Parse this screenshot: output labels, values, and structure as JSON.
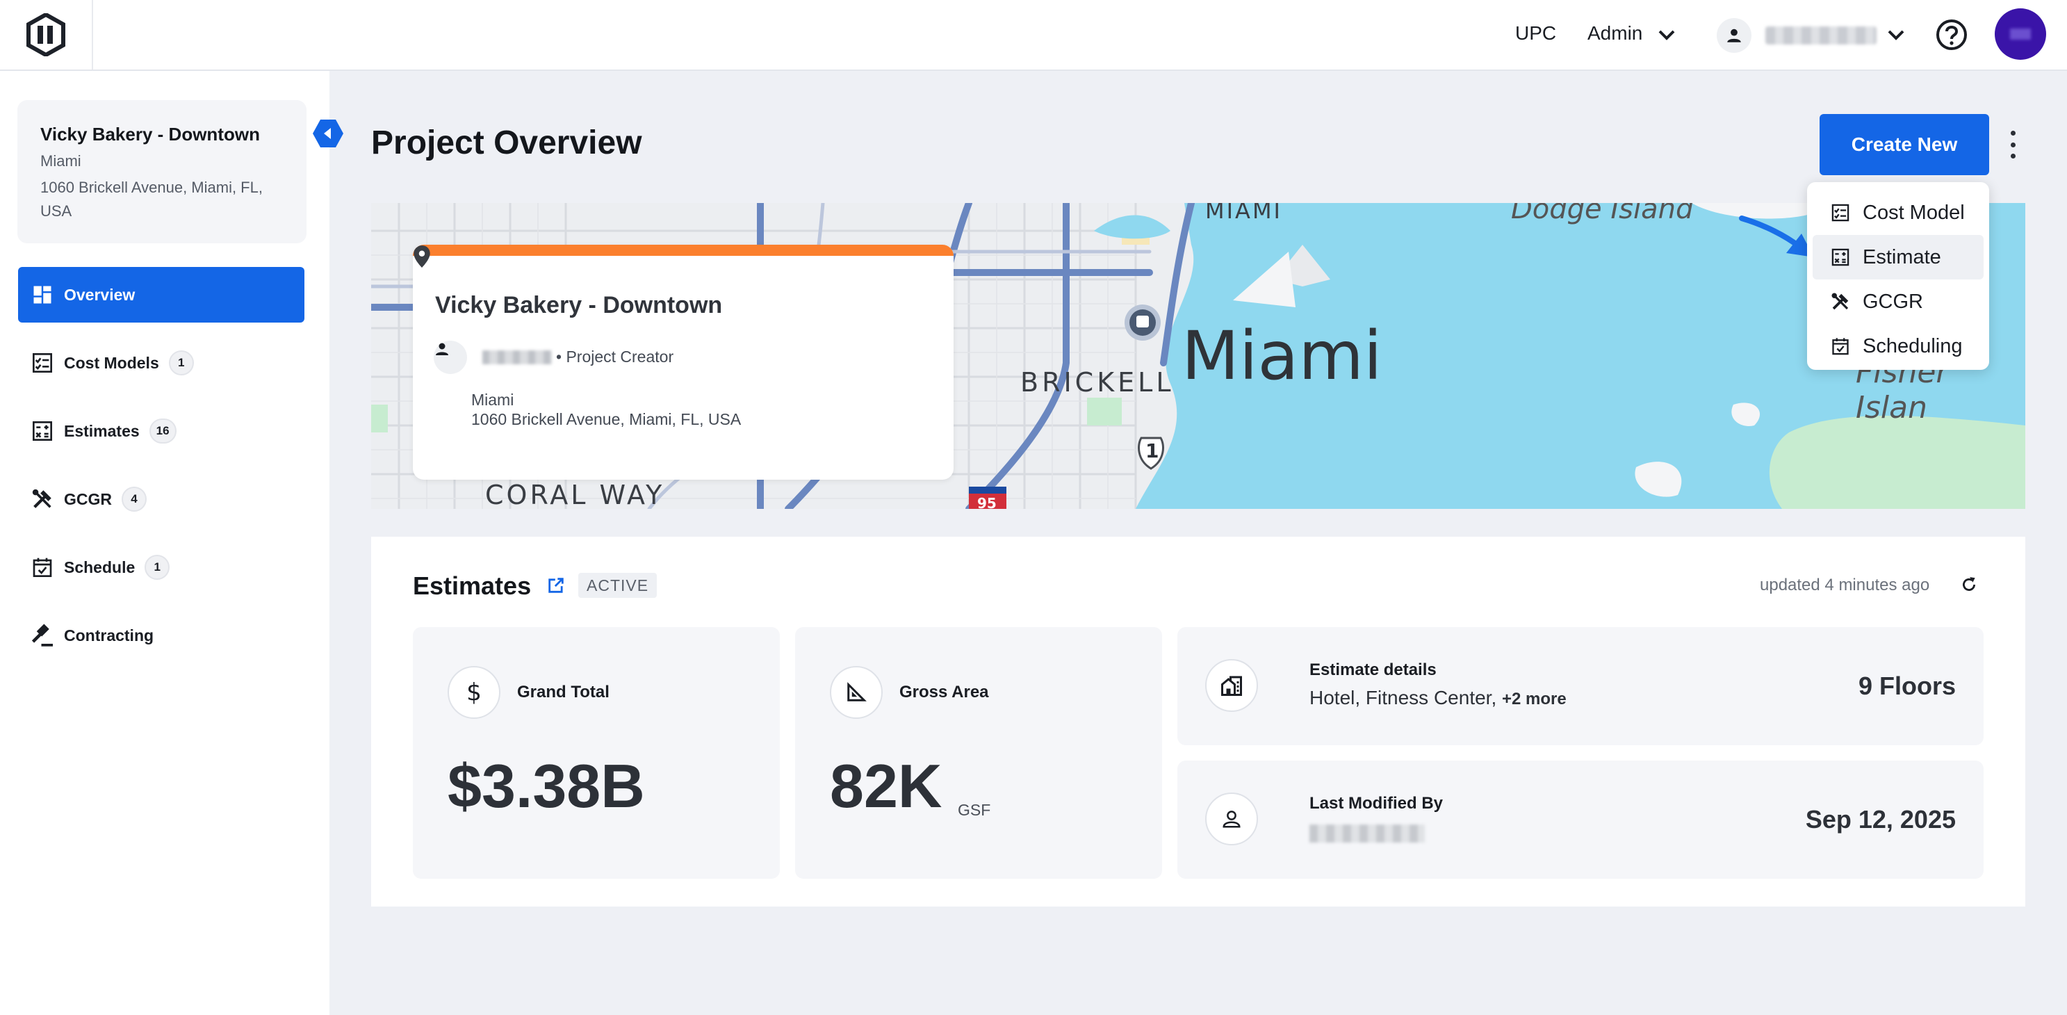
{
  "topbar": {
    "upc": "UPC",
    "admin": "Admin"
  },
  "project": {
    "name": "Vicky Bakery - Downtown",
    "city": "Miami",
    "address": "1060 Brickell Avenue, Miami, FL, USA"
  },
  "nav": [
    {
      "label": "Overview",
      "icon": "dashboard-icon",
      "badge": null,
      "active": true
    },
    {
      "label": "Cost Models",
      "icon": "checklist-icon",
      "badge": "1"
    },
    {
      "label": "Estimates",
      "icon": "calculator-icon",
      "badge": "16"
    },
    {
      "label": "GCGR",
      "icon": "tools-icon",
      "badge": "4"
    },
    {
      "label": "Schedule",
      "icon": "calendar-check-icon",
      "badge": "1"
    },
    {
      "label": "Contracting",
      "icon": "gavel-icon",
      "badge": null
    }
  ],
  "main": {
    "title": "Project Overview",
    "create_new": "Create New"
  },
  "dropdown": {
    "items": [
      {
        "label": "Cost Model",
        "icon": "checklist-icon"
      },
      {
        "label": "Estimate",
        "icon": "calculator-icon",
        "hover": true
      },
      {
        "label": "GCGR",
        "icon": "tools-icon"
      },
      {
        "label": "Scheduling",
        "icon": "calendar-check-icon"
      }
    ]
  },
  "map": {
    "labels": {
      "miami_top": "MIAMI",
      "dodge": "Dodge Island",
      "miami": "Miami",
      "brickell": "BRICKELL",
      "coral_way": "CORAL WAY",
      "fisher": "Fisher Islan",
      "us1": "1",
      "i95": "95"
    },
    "card": {
      "title": "Vicky Bakery - Downtown",
      "creator": "• Project Creator",
      "city": "Miami",
      "address": "1060 Brickell Avenue, Miami, FL, USA"
    }
  },
  "estimates": {
    "title": "Estimates",
    "status": "ACTIVE",
    "updated": "updated 4 minutes ago",
    "grand_total_label": "Grand Total",
    "grand_total_value": "$3.38B",
    "gross_area_label": "Gross Area",
    "gross_area_value": "82K",
    "gross_area_unit": "GSF",
    "details_label": "Estimate details",
    "details_value": "Hotel, Fitness Center,",
    "details_more": "+2 more",
    "floors": "9 Floors",
    "modified_label": "Last Modified By",
    "modified_date": "Sep 12, 2025"
  },
  "colors": {
    "primary": "#1466e6",
    "orange_accent": "#fb7f2d",
    "avatar": "#3a14a8",
    "water": "#8fd8ef"
  }
}
